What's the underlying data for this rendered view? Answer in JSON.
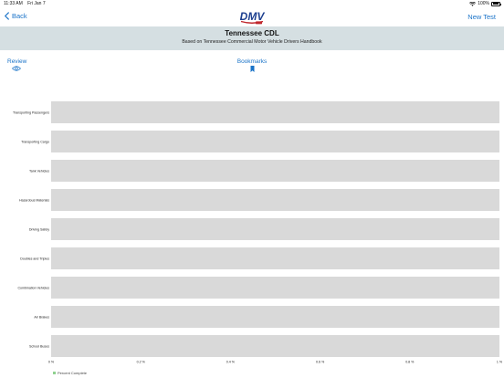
{
  "status": {
    "time": "11:33 AM",
    "date": "Fri Jan 7",
    "battery": "100%"
  },
  "nav": {
    "back_label": "Back",
    "new_test_label": "New Test",
    "logo_text": "DMV"
  },
  "header": {
    "title": "Tennessee CDL",
    "subtitle": "Based on Tennessee Commercial Motor Vehicle Drivers Handbook"
  },
  "toolbar": {
    "review_label": "Review",
    "bookmarks_label": "Bookmarks"
  },
  "colors": {
    "accent": "#1a73c8",
    "band": "#d5dfe2",
    "bar_track": "#d9d9d9",
    "complete": "#8fd18f"
  },
  "chart_data": {
    "type": "bar",
    "orientation": "horizontal",
    "categories": [
      "Transporting Passengers",
      "Transporting Cargo",
      "Tank Vehicles",
      "Hazardous Materials",
      "Driving Safely",
      "Doubles and Triples",
      "Combination Vehicles",
      "Air Brakes",
      "School Buses"
    ],
    "series": [
      {
        "name": "Percent Complete",
        "values": [
          0,
          0,
          0,
          0,
          0,
          0,
          0,
          0,
          0
        ]
      }
    ],
    "xlim": [
      0,
      1
    ],
    "xticks": [
      0,
      0.2,
      0.4,
      0.6,
      0.8,
      1
    ],
    "xtick_labels": [
      "0 %",
      "0.2 %",
      "0.4 %",
      "0.6 %",
      "0.8 %",
      "1 %"
    ],
    "grid": false,
    "legend": "bottom-left"
  }
}
